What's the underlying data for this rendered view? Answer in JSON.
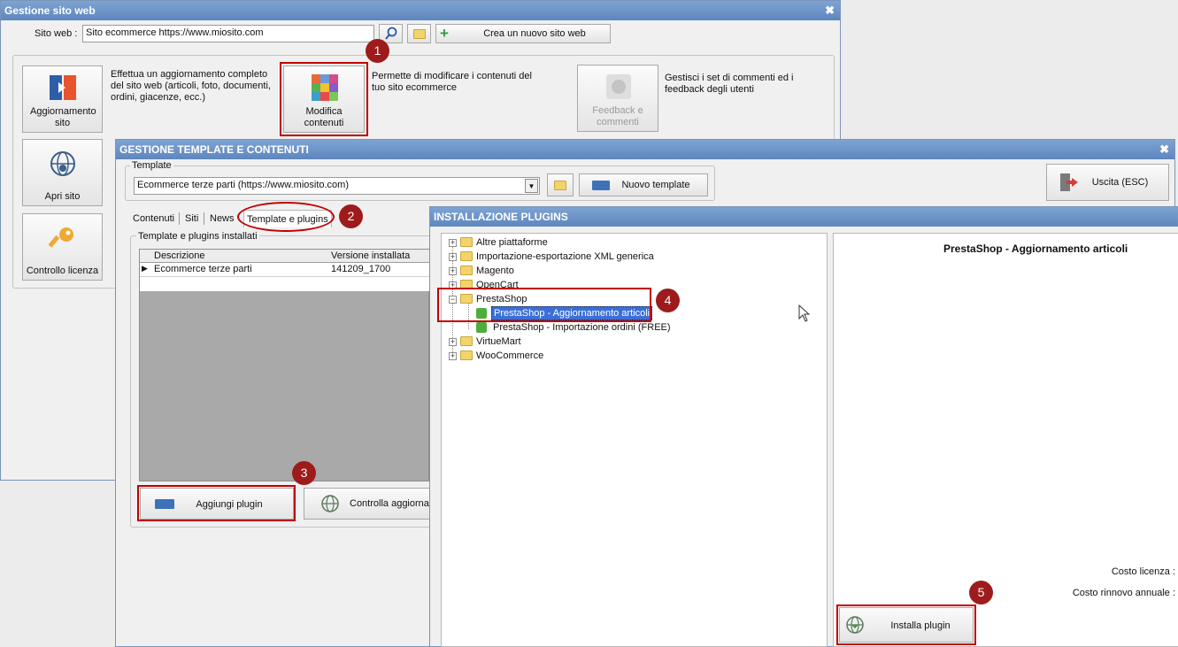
{
  "main_window": {
    "title": "Gestione sito web",
    "close": "✖",
    "site_label": "Sito web :",
    "site_value": "Sito ecommerce https://www.miosito.com",
    "new_site_button": "Crea un nuovo sito web",
    "tiles": {
      "update": "Aggiornamento sito",
      "update_desc": "Effettua un aggiornamento completo del sito web (articoli, foto, documenti, ordini, giacenze, ecc.)",
      "edit": "Modifica contenuti",
      "edit_desc": "Permette di modificare i contenuti del tuo sito ecommerce",
      "feedback": "Feedback e commenti",
      "feedback_desc": "Gestisci i set di commenti ed i feedback degli utenti",
      "open_site": "Apri sito",
      "license": "Controllo licenza"
    }
  },
  "template_window": {
    "title": "GESTIONE TEMPLATE E CONTENUTI",
    "close": "✖",
    "template_group_label": "Template",
    "template_value": "Ecommerce terze parti (https://www.miosito.com)",
    "new_template_button": "Nuovo template",
    "exit_button": "Uscita (ESC)",
    "tabs": [
      "Contenuti",
      "Siti",
      "News",
      "Template e plugins"
    ],
    "installed_group_label": "Template e plugins installati",
    "table": {
      "headers": [
        "Descrizione",
        "Versione installata"
      ],
      "rows": [
        [
          "Ecommerce terze parti",
          "141209_1700"
        ]
      ]
    },
    "add_plugin_button": "Aggiungi plugin",
    "check_updates_button": "Controlla aggiornam"
  },
  "plugins_window": {
    "title": "INSTALLAZIONE PLUGINS",
    "tree": [
      "Altre piattaforme",
      "Importazione-esportazione XML generica",
      "Magento",
      "OpenCart",
      "PrestaShop",
      "PrestaShop - Aggiornamento articoli",
      "PrestaShop - Importazione ordini (FREE)",
      "VirtueMart",
      "WooCommerce"
    ],
    "detail_title": "PrestaShop - Aggiornamento articoli",
    "license_cost_label": "Costo licenza :",
    "renewal_cost_label": "Costo rinnovo annuale :",
    "install_button": "Installa plugin"
  },
  "callouts": [
    "1",
    "2",
    "3",
    "4",
    "5"
  ],
  "colors": {
    "callout": "#9e1b1b",
    "highlight": "#c00000",
    "titlebar": "#6b90c6",
    "selection": "#3a6fd8"
  }
}
